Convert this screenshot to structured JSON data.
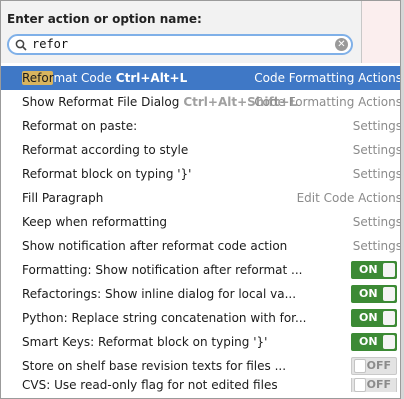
{
  "header": {
    "title": "Enter action or option name:",
    "search_value": "refor"
  },
  "icons": {
    "search": "search-icon",
    "clear": "clear-icon"
  },
  "colors": {
    "selection": "#3f78c6",
    "toggle_on": "#3c8a35",
    "highlight": "#d8b45e"
  },
  "rows": [
    {
      "name_hl": "Refor",
      "name_rest": "mat Code",
      "shortcut": "Ctrl+Alt+L",
      "category": "Code Formatting Actions"
    },
    {
      "name": "Show Reformat File Dialog",
      "shortcut": "Ctrl+Alt+Shift+L",
      "category": "Code Formatting Actions"
    },
    {
      "name": "Reformat on paste:",
      "category": "Settings"
    },
    {
      "name": "Reformat according to style",
      "category": "Settings"
    },
    {
      "name": "Reformat block on typing '}'",
      "category": "Settings"
    },
    {
      "name": "Fill Paragraph",
      "category": "Edit Code Actions"
    },
    {
      "name": "Keep when reformatting",
      "category": "Settings"
    },
    {
      "name": "Show notification after reformat code action",
      "category": "Settings"
    },
    {
      "name": "Formatting: Show notification after reformat ...",
      "toggle": "ON"
    },
    {
      "name": "Refactorings: Show inline dialog for local va...",
      "toggle": "ON"
    },
    {
      "name": "Python: Replace string concatenation with for...",
      "toggle": "ON"
    },
    {
      "name": "Smart Keys: Reformat block on typing '}'",
      "toggle": "ON"
    },
    {
      "name": "Store on shelf base revision texts for files ...",
      "toggle": "OFF"
    },
    {
      "name": "CVS: Use read-only flag for not edited files",
      "toggle": "OFF"
    }
  ]
}
